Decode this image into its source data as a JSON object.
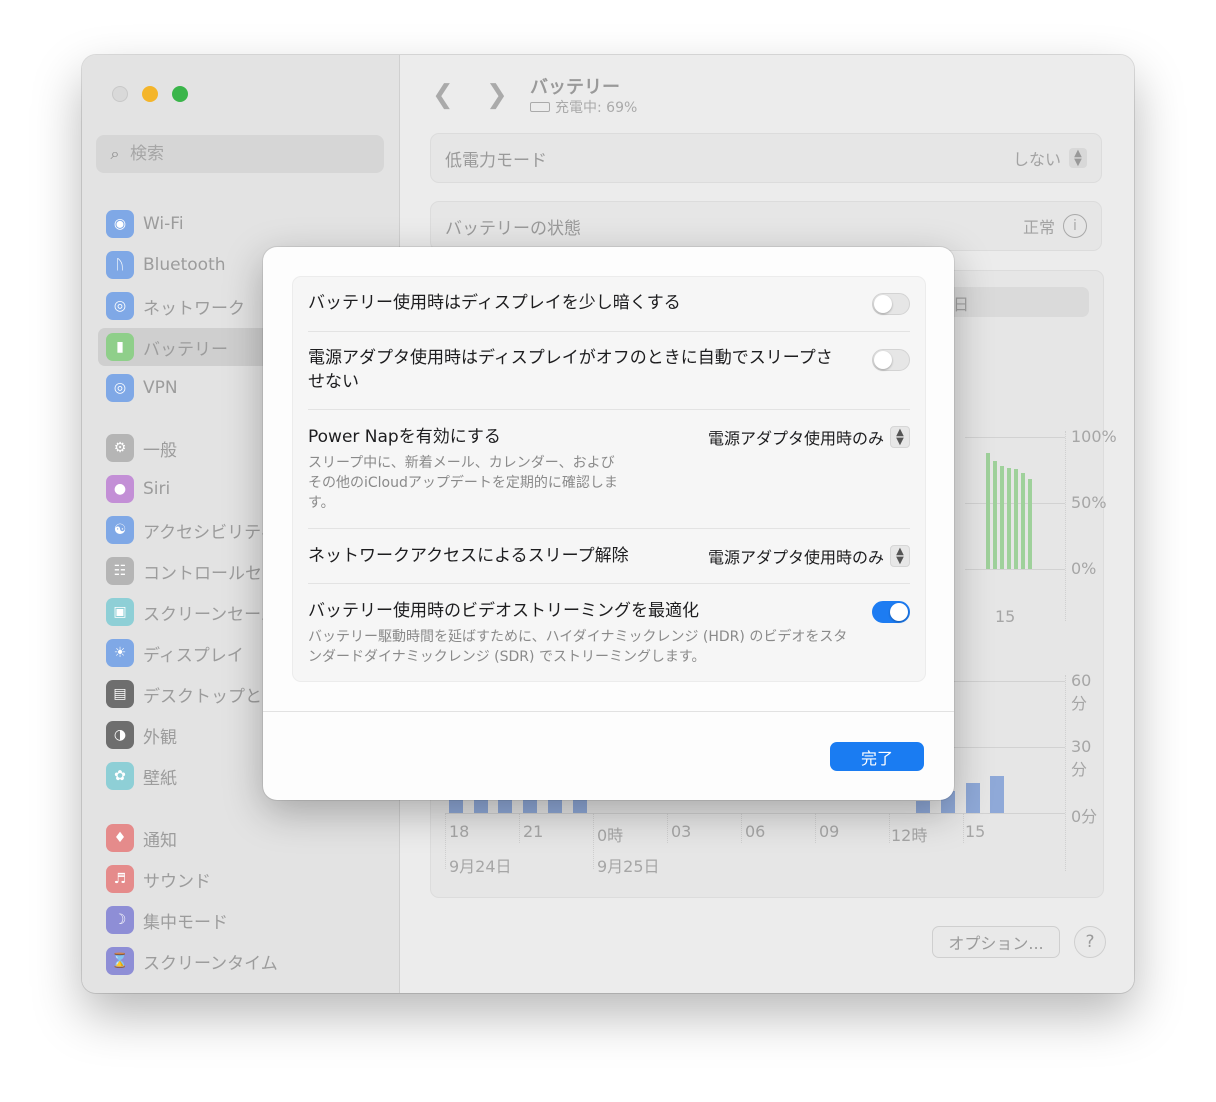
{
  "search": {
    "placeholder": "検索"
  },
  "sidebar": {
    "items": [
      {
        "label": "Wi-Fi",
        "color": "#7fa8e6"
      },
      {
        "label": "Bluetooth",
        "color": "#7fa8e6"
      },
      {
        "label": "ネットワーク",
        "color": "#7fa8e6"
      },
      {
        "label": "バッテリー",
        "color": "#8fcf8a"
      },
      {
        "label": "VPN",
        "color": "#7fa8e6"
      },
      {
        "label": "一般",
        "color": "#b5b5b5"
      },
      {
        "label": "Siri",
        "color": "#c38fd6"
      },
      {
        "label": "アクセシビリティ",
        "color": "#7fa8e6"
      },
      {
        "label": "コントロールセンター",
        "color": "#b5b5b5"
      },
      {
        "label": "スクリーンセーバー",
        "color": "#8ecfd6"
      },
      {
        "label": "ディスプレイ",
        "color": "#7fa8e6"
      },
      {
        "label": "デスクトップとDock",
        "color": "#6e6e6e"
      },
      {
        "label": "外観",
        "color": "#6e6e6e"
      },
      {
        "label": "壁紙",
        "color": "#8ecfd6"
      },
      {
        "label": "通知",
        "color": "#e58b8b"
      },
      {
        "label": "サウンド",
        "color": "#e58b8b"
      },
      {
        "label": "集中モード",
        "color": "#8e8ed6"
      },
      {
        "label": "スクリーンタイム",
        "color": "#8e8ed6"
      }
    ]
  },
  "header": {
    "title": "バッテリー",
    "status": "充電中: 69%"
  },
  "rows": {
    "low_power": {
      "label": "低電力モード",
      "value": "しない"
    },
    "health": {
      "label": "バッテリーの状態",
      "value": "正常"
    }
  },
  "chart": {
    "segment_visible": "日",
    "level_ticks": [
      "100%",
      "50%",
      "0%"
    ],
    "usage_ticks": [
      "60分",
      "30分",
      "0分"
    ],
    "top_x_label": "15",
    "x_labels": [
      "18",
      "21",
      "0時",
      "03",
      "06",
      "09",
      "12時",
      "15"
    ],
    "date_labels": [
      "9月24日",
      "9月25日"
    ]
  },
  "footer": {
    "options_label": "オプション...",
    "help_label": "?"
  },
  "modal": {
    "dim_display": {
      "title": "バッテリー使用時はディスプレイを少し暗くする",
      "on": false
    },
    "prevent_sleep": {
      "title": "電源アダプタ使用時はディスプレイがオフのときに自動でスリープさせない",
      "on": false
    },
    "power_nap": {
      "title": "Power Napを有効にする",
      "desc": "スリープ中に、新着メール、カレンダー、およびその他のiCloudアップデートを定期的に確認します。",
      "value": "電源アダプタ使用時のみ"
    },
    "wake_network": {
      "title": "ネットワークアクセスによるスリープ解除",
      "value": "電源アダプタ使用時のみ"
    },
    "video_streaming": {
      "title": "バッテリー使用時のビデオストリーミングを最適化",
      "desc": "バッテリー駆動時間を延ばすために、ハイダイナミックレンジ (HDR) のビデオをスタンダードダイナミックレンジ (SDR) でストリーミングします。",
      "on": true
    },
    "done_label": "完了"
  }
}
